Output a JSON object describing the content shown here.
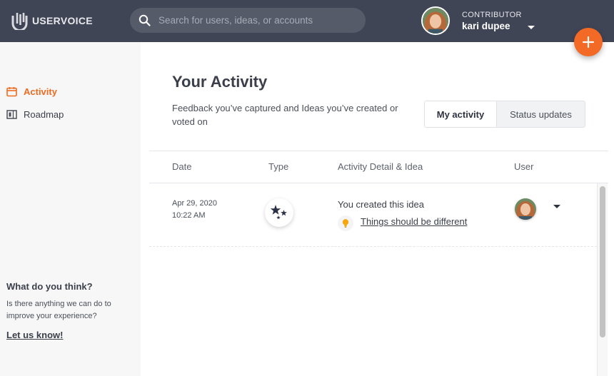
{
  "brand": {
    "name": "USERVOICE",
    "accent": "#ef6b21",
    "topbar_bg": "#404555"
  },
  "search": {
    "placeholder": "Search for users, ideas, or accounts"
  },
  "user": {
    "role": "CONTRIBUTOR",
    "name": "kari dupee"
  },
  "sidebar": {
    "items": [
      {
        "label": "Activity",
        "icon": "calendar-icon",
        "active": true
      },
      {
        "label": "Roadmap",
        "icon": "roadmap-icon",
        "active": false
      }
    ],
    "feedback": {
      "title": "What do you think?",
      "text": "Is there anything we can do to improve your experience?",
      "link": "Let us know!"
    }
  },
  "main": {
    "title": "Your Activity",
    "subtitle": "Feedback you’ve captured and Ideas you’ve created or voted on",
    "tabs": [
      {
        "label": "My activity",
        "selected": true
      },
      {
        "label": "Status updates",
        "selected": false
      }
    ],
    "table": {
      "headers": [
        "Date",
        "Type",
        "Activity Detail & Idea",
        "User"
      ],
      "rows": [
        {
          "date": "Apr 29, 2020",
          "time": "10:22 AM",
          "type_icon": "stars-icon",
          "detail": "You created this idea",
          "idea": "Things should be different",
          "idea_icon": "lightbulb-icon"
        }
      ]
    }
  }
}
